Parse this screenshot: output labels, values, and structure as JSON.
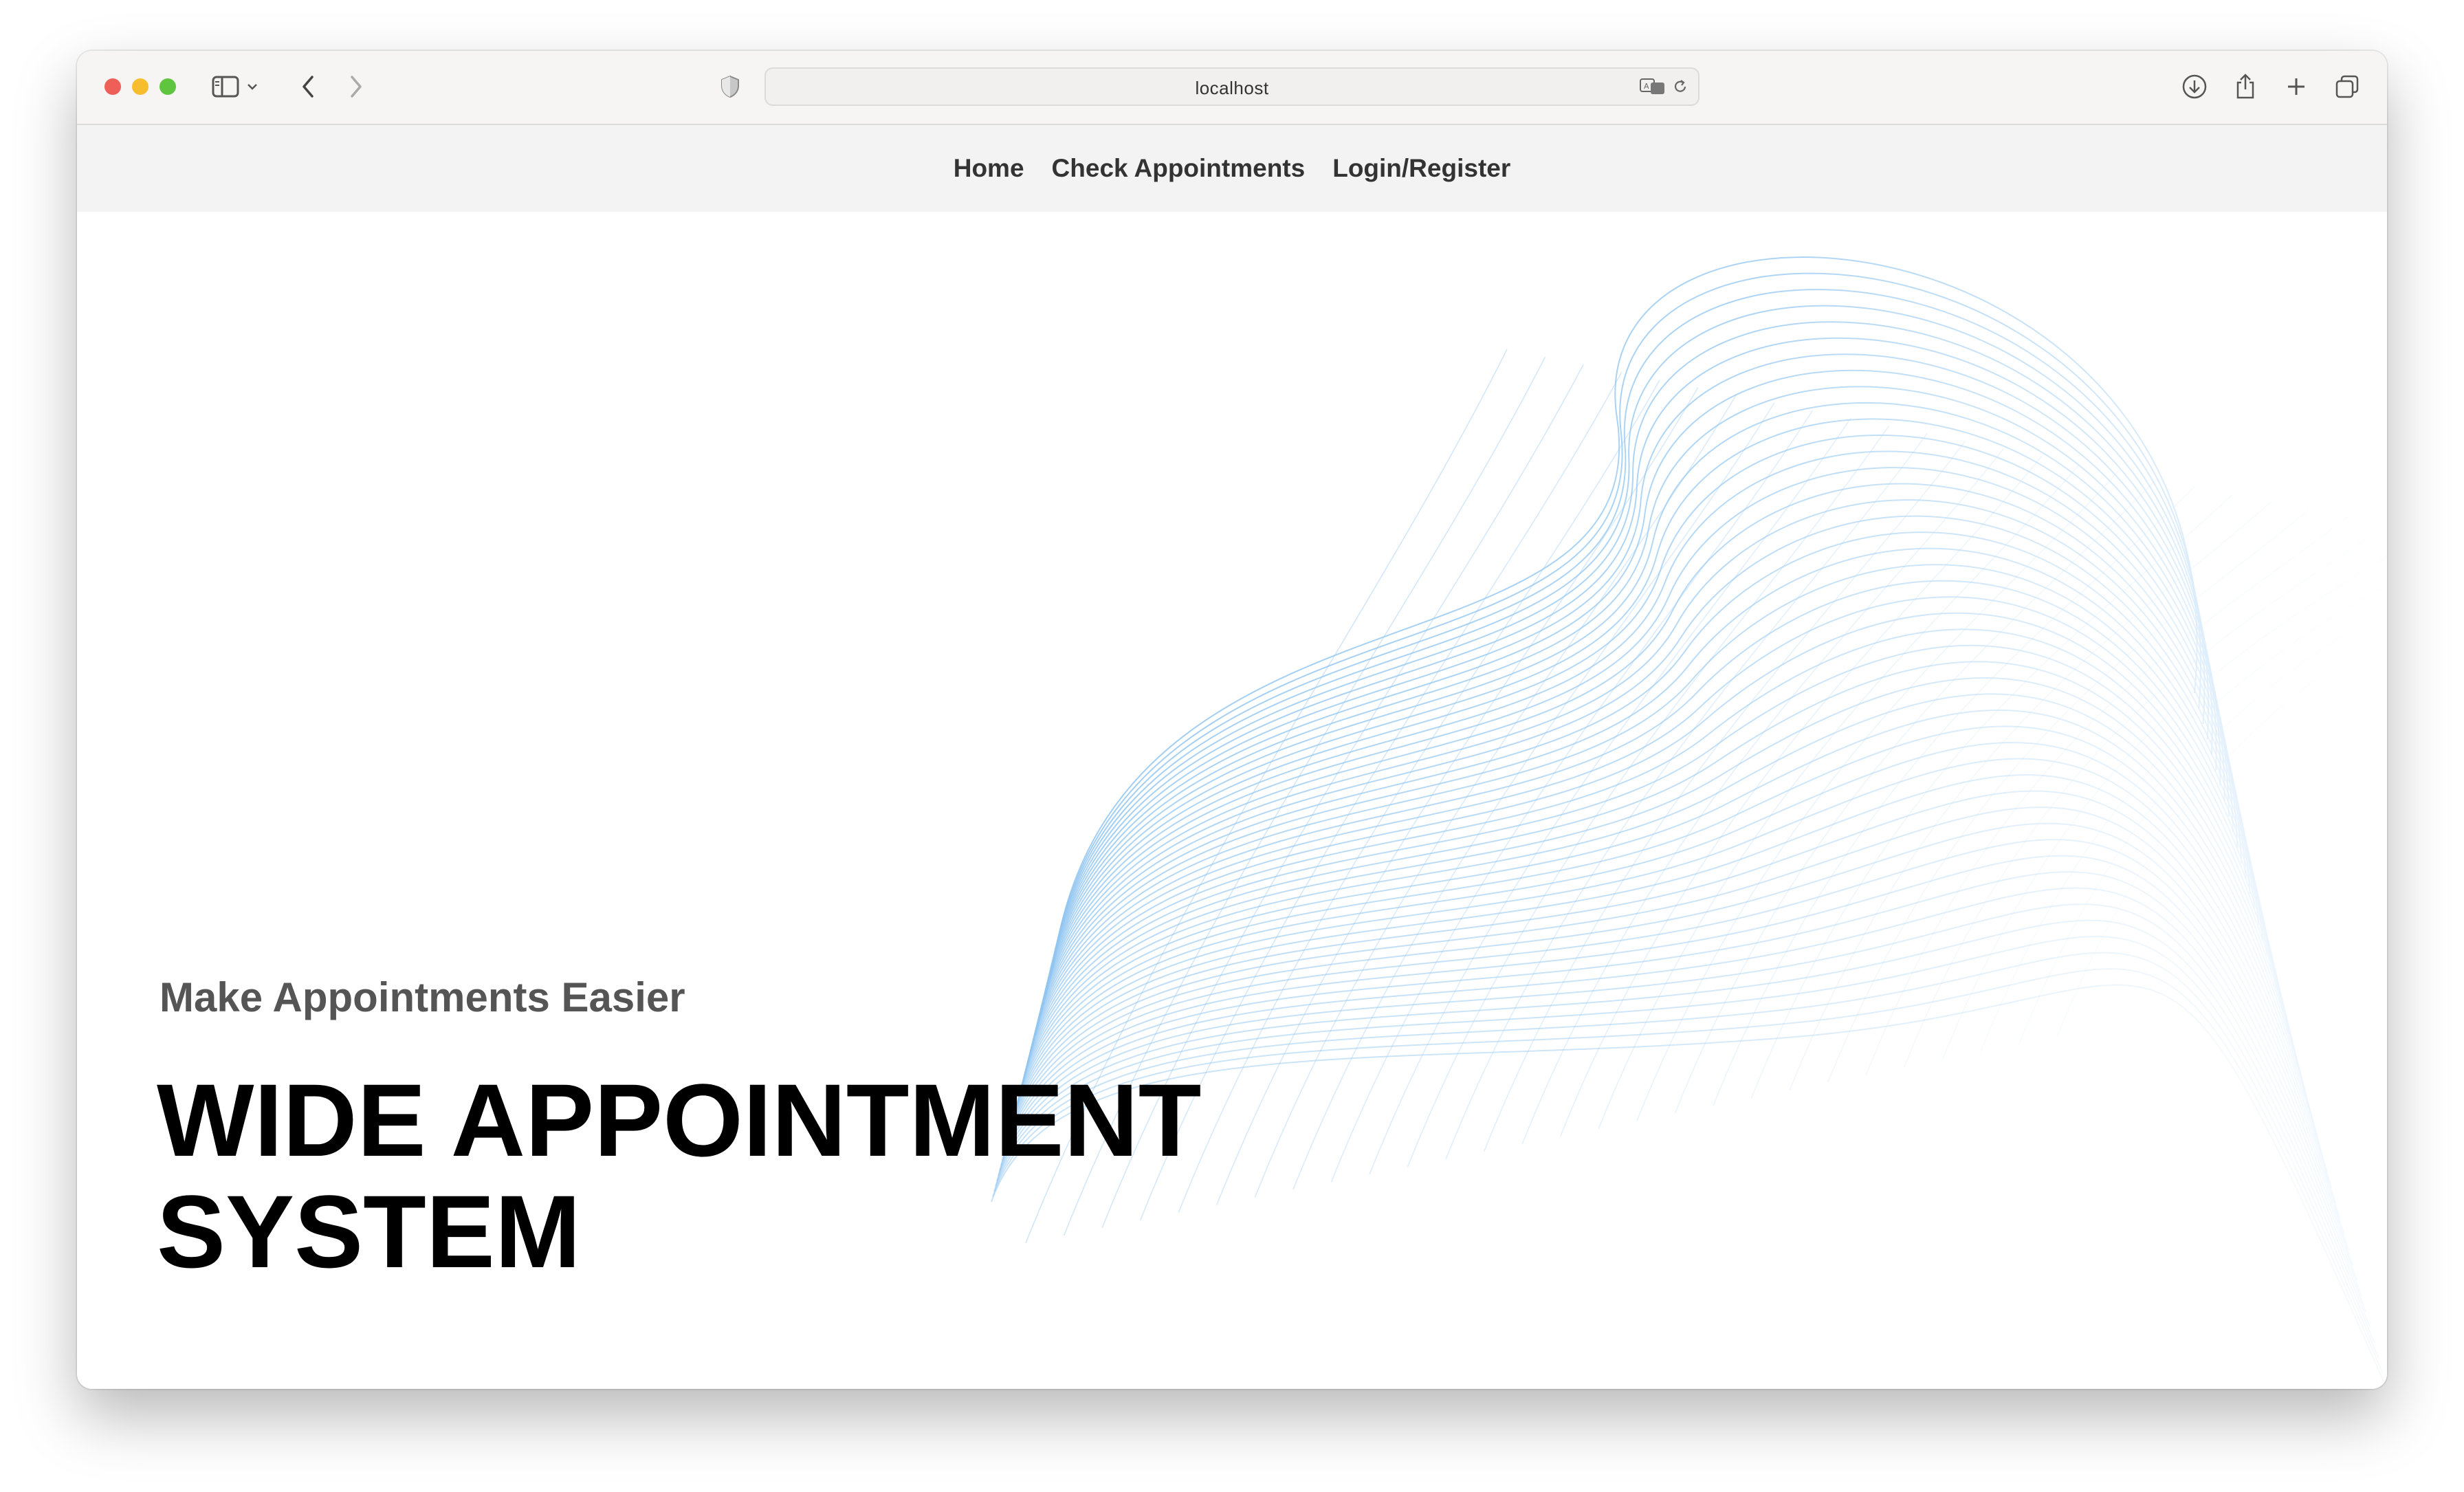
{
  "browser": {
    "url": "localhost"
  },
  "nav": {
    "items": [
      {
        "label": "Home"
      },
      {
        "label": "Check Appointments"
      },
      {
        "label": "Login/Register"
      }
    ]
  },
  "hero": {
    "subtitle": "Make Appointments Easier",
    "title_line1": "WIDE APPOINTMENT",
    "title_line2": "SYSTEM"
  },
  "colors": {
    "wave": "#8cc3f0",
    "navbar_bg": "#f3f3f3",
    "subtitle": "#555555",
    "title": "#000000"
  },
  "icons": [
    "sidebar-icon",
    "chevron-down-icon",
    "back-icon",
    "forward-icon",
    "shield-icon",
    "translate-icon",
    "reload-icon",
    "download-icon",
    "share-icon",
    "new-tab-icon",
    "tabs-overview-icon"
  ]
}
